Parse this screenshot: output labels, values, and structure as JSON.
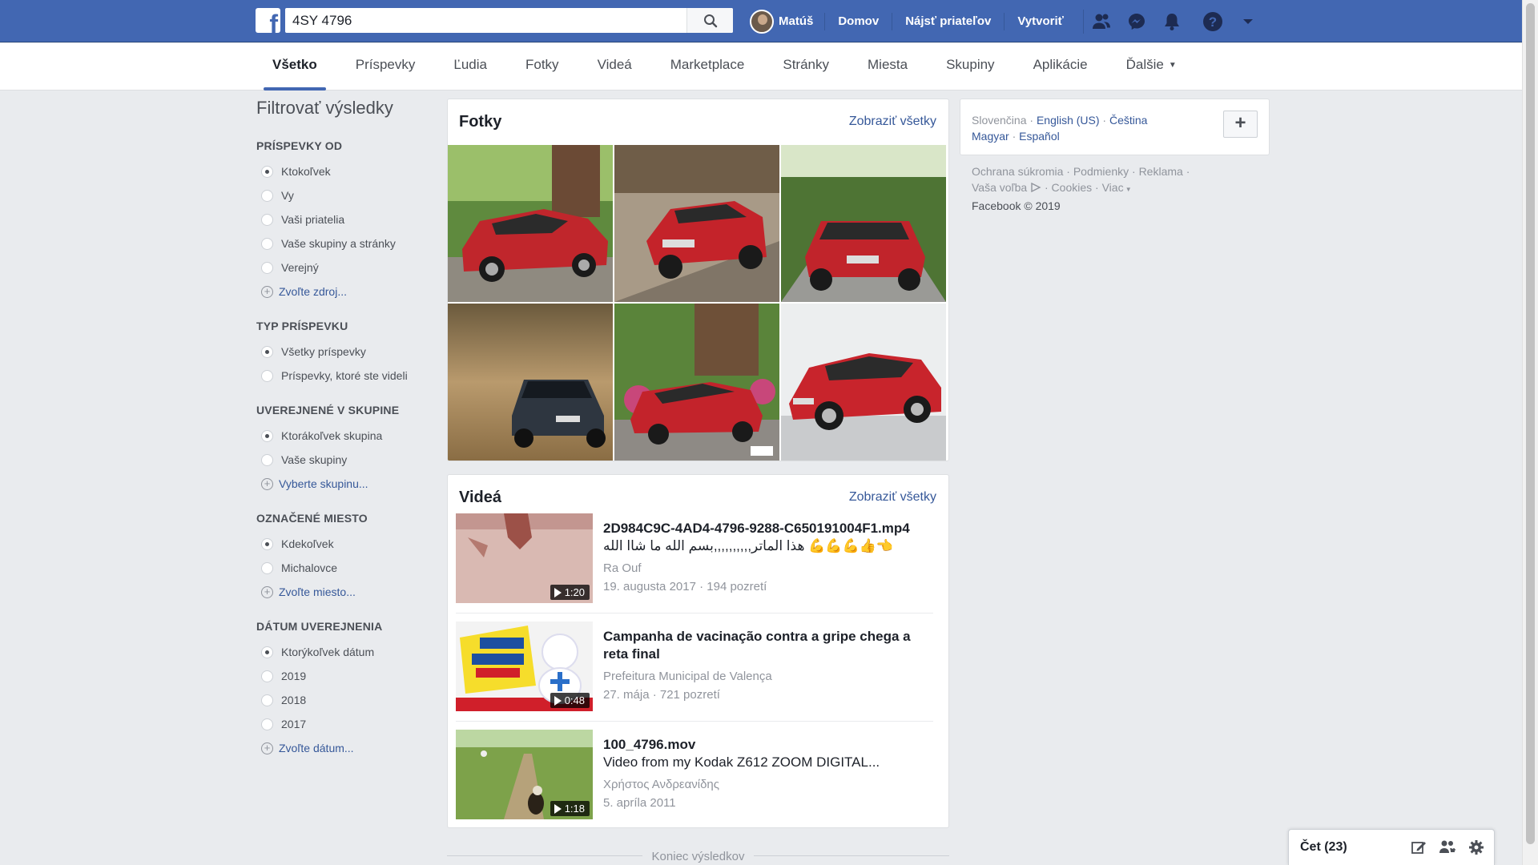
{
  "topbar": {
    "logo": "f",
    "search_value": "4SY 4796",
    "user_name": "Matúš",
    "links": [
      "Domov",
      "Nájsť priateľov",
      "Vytvoriť"
    ],
    "icons": [
      "friends-icon",
      "messenger-icon",
      "bell-icon",
      "help-icon",
      "caret-down-icon"
    ]
  },
  "tabs": [
    "Všetko",
    "Príspevky",
    "Ľudia",
    "Fotky",
    "Videá",
    "Marketplace",
    "Stránky",
    "Miesta",
    "Skupiny",
    "Aplikácie",
    "Ďalšie"
  ],
  "filters": {
    "title": "Filtrovať výsledky",
    "groups": [
      {
        "heading": "PRÍSPEVKY OD",
        "options": [
          "Ktokoľvek",
          "Vy",
          "Vaši priatelia",
          "Vaše skupiny a stránky",
          "Verejný"
        ],
        "link": "Zvoľte zdroj..."
      },
      {
        "heading": "TYP PRÍSPEVKU",
        "options": [
          "Všetky príspevky",
          "Príspevky, ktoré ste videli"
        ],
        "link": ""
      },
      {
        "heading": "UVEREJNENÉ V SKUPINE",
        "options": [
          "Ktorákoľvek skupina",
          "Vaše skupiny"
        ],
        "link": "Vyberte skupinu..."
      },
      {
        "heading": "OZNAČENÉ MIESTO",
        "options": [
          "Kdekoľvek",
          "Michalovce"
        ],
        "link": "Zvoľte miesto..."
      },
      {
        "heading": "DÁTUM UVEREJNENIA",
        "options": [
          "Ktorýkoľvek dátum",
          "2019",
          "2018",
          "2017"
        ],
        "link": "Zvoľte dátum..."
      }
    ]
  },
  "photos": {
    "title": "Fotky",
    "see_all": "Zobraziť všetky"
  },
  "videos": {
    "title": "Videá",
    "see_all": "Zobraziť všetky",
    "items": [
      {
        "title": "2D984C9C-4AD4-4796-9288-C650191004F1.mp4",
        "desc": "هذا الماتر,,,,,,,,,,بسم الله ما شاا الله 💪💪💪👍👈",
        "author": "Ra Ouf",
        "meta": "19. augusta 2017 · 194 pozretí",
        "duration": "1:20"
      },
      {
        "title": "Campanha de vacinação contra a gripe chega a reta final",
        "desc": "",
        "author": "Prefeitura Municipal de Valença",
        "meta": "27. mája · 721 pozretí",
        "duration": "0:48"
      },
      {
        "title": "100_4796.mov",
        "desc": "Video from my Kodak Z612 ZOOM DIGITAL...",
        "author": "Χρήστος Ανδρεανίδης",
        "meta": "5. apríla 2011",
        "duration": "1:18"
      }
    ]
  },
  "end_of_results": "Koniec výsledkov",
  "languages": {
    "current": "Slovenčina",
    "others": [
      "English (US)",
      "Čeština",
      "Magyar",
      "Español"
    ]
  },
  "footer": {
    "row1": [
      "Ochrana súkromia",
      "Podmienky",
      "Reklama"
    ],
    "row2": [
      "Vaša voľba",
      "Cookies",
      "Viac"
    ],
    "copyright": "Facebook © 2019"
  },
  "chat": {
    "label": "Čet (23)"
  },
  "colors": {
    "brand": "#4267b2",
    "link": "#365899",
    "bg": "#e9ebee"
  }
}
